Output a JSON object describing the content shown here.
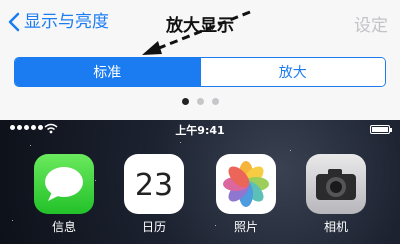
{
  "navbar": {
    "back_label": "显示与亮度",
    "title": "放大显示",
    "right_label": "设定"
  },
  "segment": {
    "options": [
      "标准",
      "放大"
    ],
    "selected": "标准"
  },
  "page_indicator": {
    "count": 3,
    "current": 1
  },
  "statusbar": {
    "time": "上午9:41"
  },
  "apps": [
    {
      "label": "信息",
      "icon": "messages-icon"
    },
    {
      "label": "日历",
      "icon": "calendar-icon",
      "weekday": "",
      "date": "23"
    },
    {
      "label": "照片",
      "icon": "photos-icon"
    },
    {
      "label": "相机",
      "icon": "camera-icon"
    }
  ],
  "colors": {
    "accent": "#1b7cf2",
    "messages": "#22c12a"
  }
}
